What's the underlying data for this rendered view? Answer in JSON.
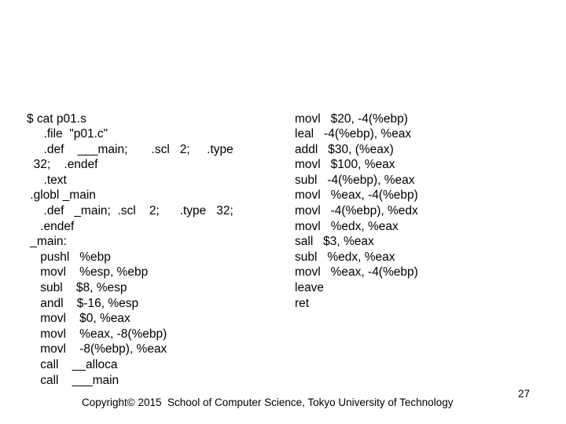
{
  "slide": {
    "background_color": "#ffffff",
    "text_color": "#000000",
    "number": "27"
  },
  "listing": {
    "left_column": {
      "name": "assembly-listing-left",
      "lines": [
        "$ cat p01.s",
        "     .file  \"p01.c\"",
        "     .def    ___main;       .scl   2;     .type",
        "  32;    .endef",
        "     .text",
        " .globl _main",
        "     .def   _main;  .scl    2;      .type   32;",
        "    .endef",
        " _main:",
        "    pushl   %ebp",
        "    movl    %esp, %ebp",
        "    subl    $8, %esp",
        "    andl    $-16, %esp",
        "    movl    $0, %eax",
        "    movl    %eax, -8(%ebp)",
        "    movl    -8(%ebp), %eax",
        "    call    __alloca",
        "    call    ___main"
      ]
    },
    "right_column": {
      "name": "assembly-listing-right",
      "lines": [
        "movl   $20, -4(%ebp)",
        "leal   -4(%ebp), %eax",
        "addl   $30, (%eax)",
        "movl   $100, %eax",
        "subl   -4(%ebp), %eax",
        "movl   %eax, -4(%ebp)",
        "movl   -4(%ebp), %edx",
        "movl   %edx, %eax",
        "sall   $3, %eax",
        "subl   %edx, %eax",
        "movl   %eax, -4(%ebp)",
        "leave",
        "ret"
      ]
    }
  },
  "footer": {
    "copyright": "Copyright© 2015  School of Computer Science, Tokyo University of Technology"
  }
}
